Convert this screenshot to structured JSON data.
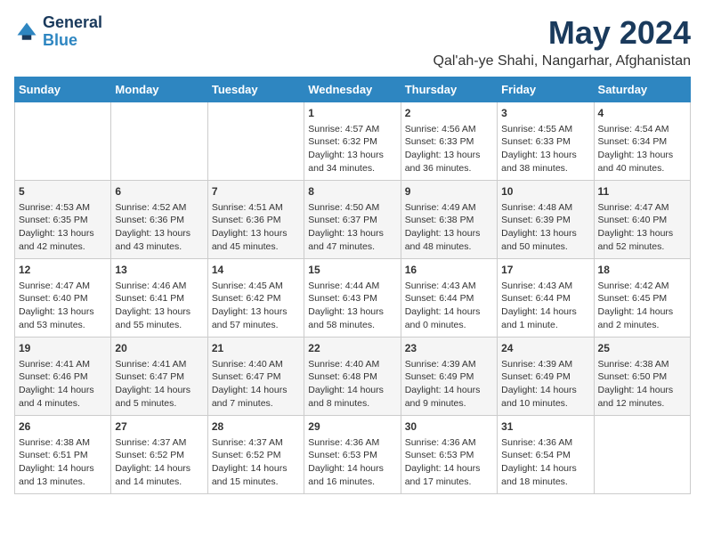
{
  "logo": {
    "line1": "General",
    "line2": "Blue"
  },
  "title": "May 2024",
  "location": "Qal'ah-ye Shahi, Nangarhar, Afghanistan",
  "weekdays": [
    "Sunday",
    "Monday",
    "Tuesday",
    "Wednesday",
    "Thursday",
    "Friday",
    "Saturday"
  ],
  "weeks": [
    [
      {
        "day": "",
        "info": ""
      },
      {
        "day": "",
        "info": ""
      },
      {
        "day": "",
        "info": ""
      },
      {
        "day": "1",
        "info": "Sunrise: 4:57 AM\nSunset: 6:32 PM\nDaylight: 13 hours\nand 34 minutes."
      },
      {
        "day": "2",
        "info": "Sunrise: 4:56 AM\nSunset: 6:33 PM\nDaylight: 13 hours\nand 36 minutes."
      },
      {
        "day": "3",
        "info": "Sunrise: 4:55 AM\nSunset: 6:33 PM\nDaylight: 13 hours\nand 38 minutes."
      },
      {
        "day": "4",
        "info": "Sunrise: 4:54 AM\nSunset: 6:34 PM\nDaylight: 13 hours\nand 40 minutes."
      }
    ],
    [
      {
        "day": "5",
        "info": "Sunrise: 4:53 AM\nSunset: 6:35 PM\nDaylight: 13 hours\nand 42 minutes."
      },
      {
        "day": "6",
        "info": "Sunrise: 4:52 AM\nSunset: 6:36 PM\nDaylight: 13 hours\nand 43 minutes."
      },
      {
        "day": "7",
        "info": "Sunrise: 4:51 AM\nSunset: 6:36 PM\nDaylight: 13 hours\nand 45 minutes."
      },
      {
        "day": "8",
        "info": "Sunrise: 4:50 AM\nSunset: 6:37 PM\nDaylight: 13 hours\nand 47 minutes."
      },
      {
        "day": "9",
        "info": "Sunrise: 4:49 AM\nSunset: 6:38 PM\nDaylight: 13 hours\nand 48 minutes."
      },
      {
        "day": "10",
        "info": "Sunrise: 4:48 AM\nSunset: 6:39 PM\nDaylight: 13 hours\nand 50 minutes."
      },
      {
        "day": "11",
        "info": "Sunrise: 4:47 AM\nSunset: 6:40 PM\nDaylight: 13 hours\nand 52 minutes."
      }
    ],
    [
      {
        "day": "12",
        "info": "Sunrise: 4:47 AM\nSunset: 6:40 PM\nDaylight: 13 hours\nand 53 minutes."
      },
      {
        "day": "13",
        "info": "Sunrise: 4:46 AM\nSunset: 6:41 PM\nDaylight: 13 hours\nand 55 minutes."
      },
      {
        "day": "14",
        "info": "Sunrise: 4:45 AM\nSunset: 6:42 PM\nDaylight: 13 hours\nand 57 minutes."
      },
      {
        "day": "15",
        "info": "Sunrise: 4:44 AM\nSunset: 6:43 PM\nDaylight: 13 hours\nand 58 minutes."
      },
      {
        "day": "16",
        "info": "Sunrise: 4:43 AM\nSunset: 6:44 PM\nDaylight: 14 hours\nand 0 minutes."
      },
      {
        "day": "17",
        "info": "Sunrise: 4:43 AM\nSunset: 6:44 PM\nDaylight: 14 hours\nand 1 minute."
      },
      {
        "day": "18",
        "info": "Sunrise: 4:42 AM\nSunset: 6:45 PM\nDaylight: 14 hours\nand 2 minutes."
      }
    ],
    [
      {
        "day": "19",
        "info": "Sunrise: 4:41 AM\nSunset: 6:46 PM\nDaylight: 14 hours\nand 4 minutes."
      },
      {
        "day": "20",
        "info": "Sunrise: 4:41 AM\nSunset: 6:47 PM\nDaylight: 14 hours\nand 5 minutes."
      },
      {
        "day": "21",
        "info": "Sunrise: 4:40 AM\nSunset: 6:47 PM\nDaylight: 14 hours\nand 7 minutes."
      },
      {
        "day": "22",
        "info": "Sunrise: 4:40 AM\nSunset: 6:48 PM\nDaylight: 14 hours\nand 8 minutes."
      },
      {
        "day": "23",
        "info": "Sunrise: 4:39 AM\nSunset: 6:49 PM\nDaylight: 14 hours\nand 9 minutes."
      },
      {
        "day": "24",
        "info": "Sunrise: 4:39 AM\nSunset: 6:49 PM\nDaylight: 14 hours\nand 10 minutes."
      },
      {
        "day": "25",
        "info": "Sunrise: 4:38 AM\nSunset: 6:50 PM\nDaylight: 14 hours\nand 12 minutes."
      }
    ],
    [
      {
        "day": "26",
        "info": "Sunrise: 4:38 AM\nSunset: 6:51 PM\nDaylight: 14 hours\nand 13 minutes."
      },
      {
        "day": "27",
        "info": "Sunrise: 4:37 AM\nSunset: 6:52 PM\nDaylight: 14 hours\nand 14 minutes."
      },
      {
        "day": "28",
        "info": "Sunrise: 4:37 AM\nSunset: 6:52 PM\nDaylight: 14 hours\nand 15 minutes."
      },
      {
        "day": "29",
        "info": "Sunrise: 4:36 AM\nSunset: 6:53 PM\nDaylight: 14 hours\nand 16 minutes."
      },
      {
        "day": "30",
        "info": "Sunrise: 4:36 AM\nSunset: 6:53 PM\nDaylight: 14 hours\nand 17 minutes."
      },
      {
        "day": "31",
        "info": "Sunrise: 4:36 AM\nSunset: 6:54 PM\nDaylight: 14 hours\nand 18 minutes."
      },
      {
        "day": "",
        "info": ""
      }
    ]
  ]
}
